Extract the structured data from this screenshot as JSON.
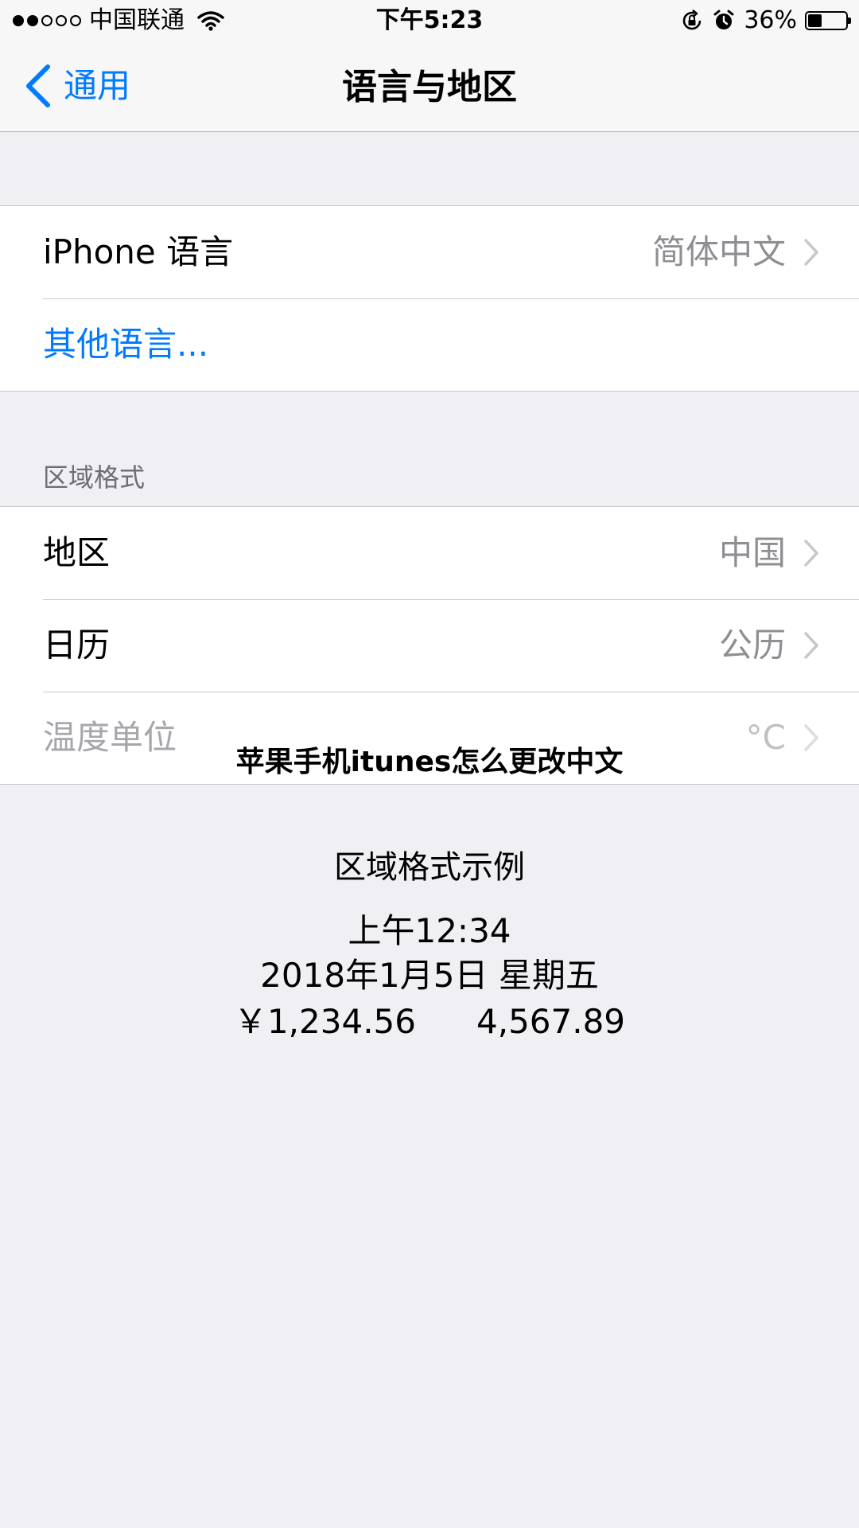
{
  "status_bar": {
    "carrier": "中国联通",
    "time": "下午5:23",
    "battery_percent": "36%",
    "battery_level": 0.36,
    "signal_filled_dots": 2,
    "signal_total_dots": 5,
    "icons": [
      "wifi-icon",
      "rotation-lock-icon",
      "alarm-icon",
      "battery-icon"
    ]
  },
  "nav": {
    "back_label": "通用",
    "title": "语言与地区",
    "accent_color": "#007aff"
  },
  "language_group": {
    "iphone_language": {
      "label": "iPhone 语言",
      "value": "简体中文"
    },
    "other_languages": {
      "label": "其他语言..."
    }
  },
  "region_group": {
    "header": "区域格式",
    "region": {
      "label": "地区",
      "value": "中国"
    },
    "calendar": {
      "label": "日历",
      "value": "公历"
    },
    "temperature": {
      "label": "温度单位",
      "value": "°C"
    }
  },
  "overlay_caption": "苹果手机itunes怎么更改中文",
  "format_example": {
    "title": "区域格式示例",
    "time": "上午12:34",
    "date": "2018年1月5日 星期五",
    "currency": "￥1,234.56",
    "number": "4,567.89"
  }
}
